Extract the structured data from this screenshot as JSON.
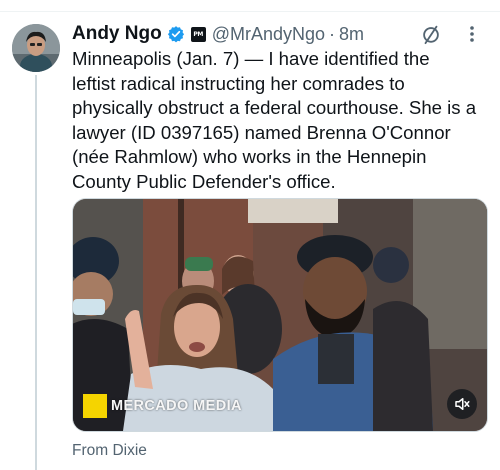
{
  "tweet": {
    "display_name": "Andy Ngo",
    "handle": "@MrAndyNgo",
    "separator": "·",
    "time": "8m",
    "affiliate_badge_text": "PM",
    "text": "Minneapolis (Jan. 7) — I have identified the\nleftist radical instructing her comrades to\nphysically obstruct a federal courthouse. She is a\nlawyer (ID 0397165) named Brenna O'Connor\n(née Rahmlow) who works in the Hennepin\nCounty Public Defender's office.",
    "media": {
      "watermark": "MERCADO MEDIA",
      "icons": [
        "volume-muted-icon"
      ]
    },
    "footer_note": "From Dixie"
  },
  "icons": {
    "verified": "verified-badge-icon",
    "mute": "mute-conversation-icon",
    "more": "more-options-icon"
  },
  "colors": {
    "verified_blue": "#1d9bf0",
    "secondary_text": "#536471",
    "watermark_yellow": "#f5d400"
  }
}
